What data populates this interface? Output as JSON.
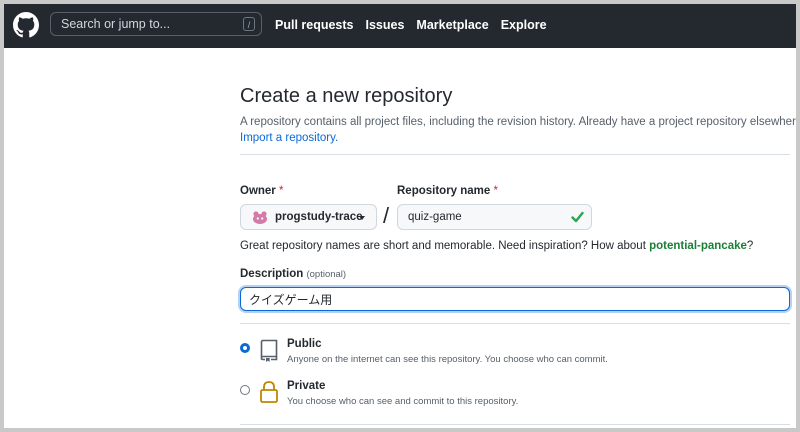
{
  "header": {
    "search_placeholder": "Search or jump to...",
    "search_shortcut": "/",
    "nav": [
      "Pull requests",
      "Issues",
      "Marketplace",
      "Explore"
    ]
  },
  "page": {
    "title": "Create a new repository",
    "subtitle": "A repository contains all project files, including the revision history. Already have a project repository elsewhere?",
    "import_link": "Import a repository."
  },
  "form": {
    "owner_label": "Owner",
    "required_mark": "*",
    "owner_value": "progstudy-trace",
    "separator": "/",
    "repo_label": "Repository name",
    "repo_value": "quiz-game",
    "hint_prefix": "Great repository names are short and memorable. Need inspiration? How about ",
    "hint_suggestion": "potential-pancake",
    "hint_suffix": "?",
    "description_label": "Description",
    "description_optional": "(optional)",
    "description_value": "クイズゲーム用"
  },
  "visibility": {
    "public": {
      "title": "Public",
      "desc": "Anyone on the internet can see this repository. You choose who can commit.",
      "selected": true
    },
    "private": {
      "title": "Private",
      "desc": "You choose who can see and commit to this repository.",
      "selected": false
    }
  },
  "colors": {
    "header_bg": "#24292f",
    "link": "#0969da",
    "success": "#1a7f37",
    "required": "#cf222e"
  }
}
